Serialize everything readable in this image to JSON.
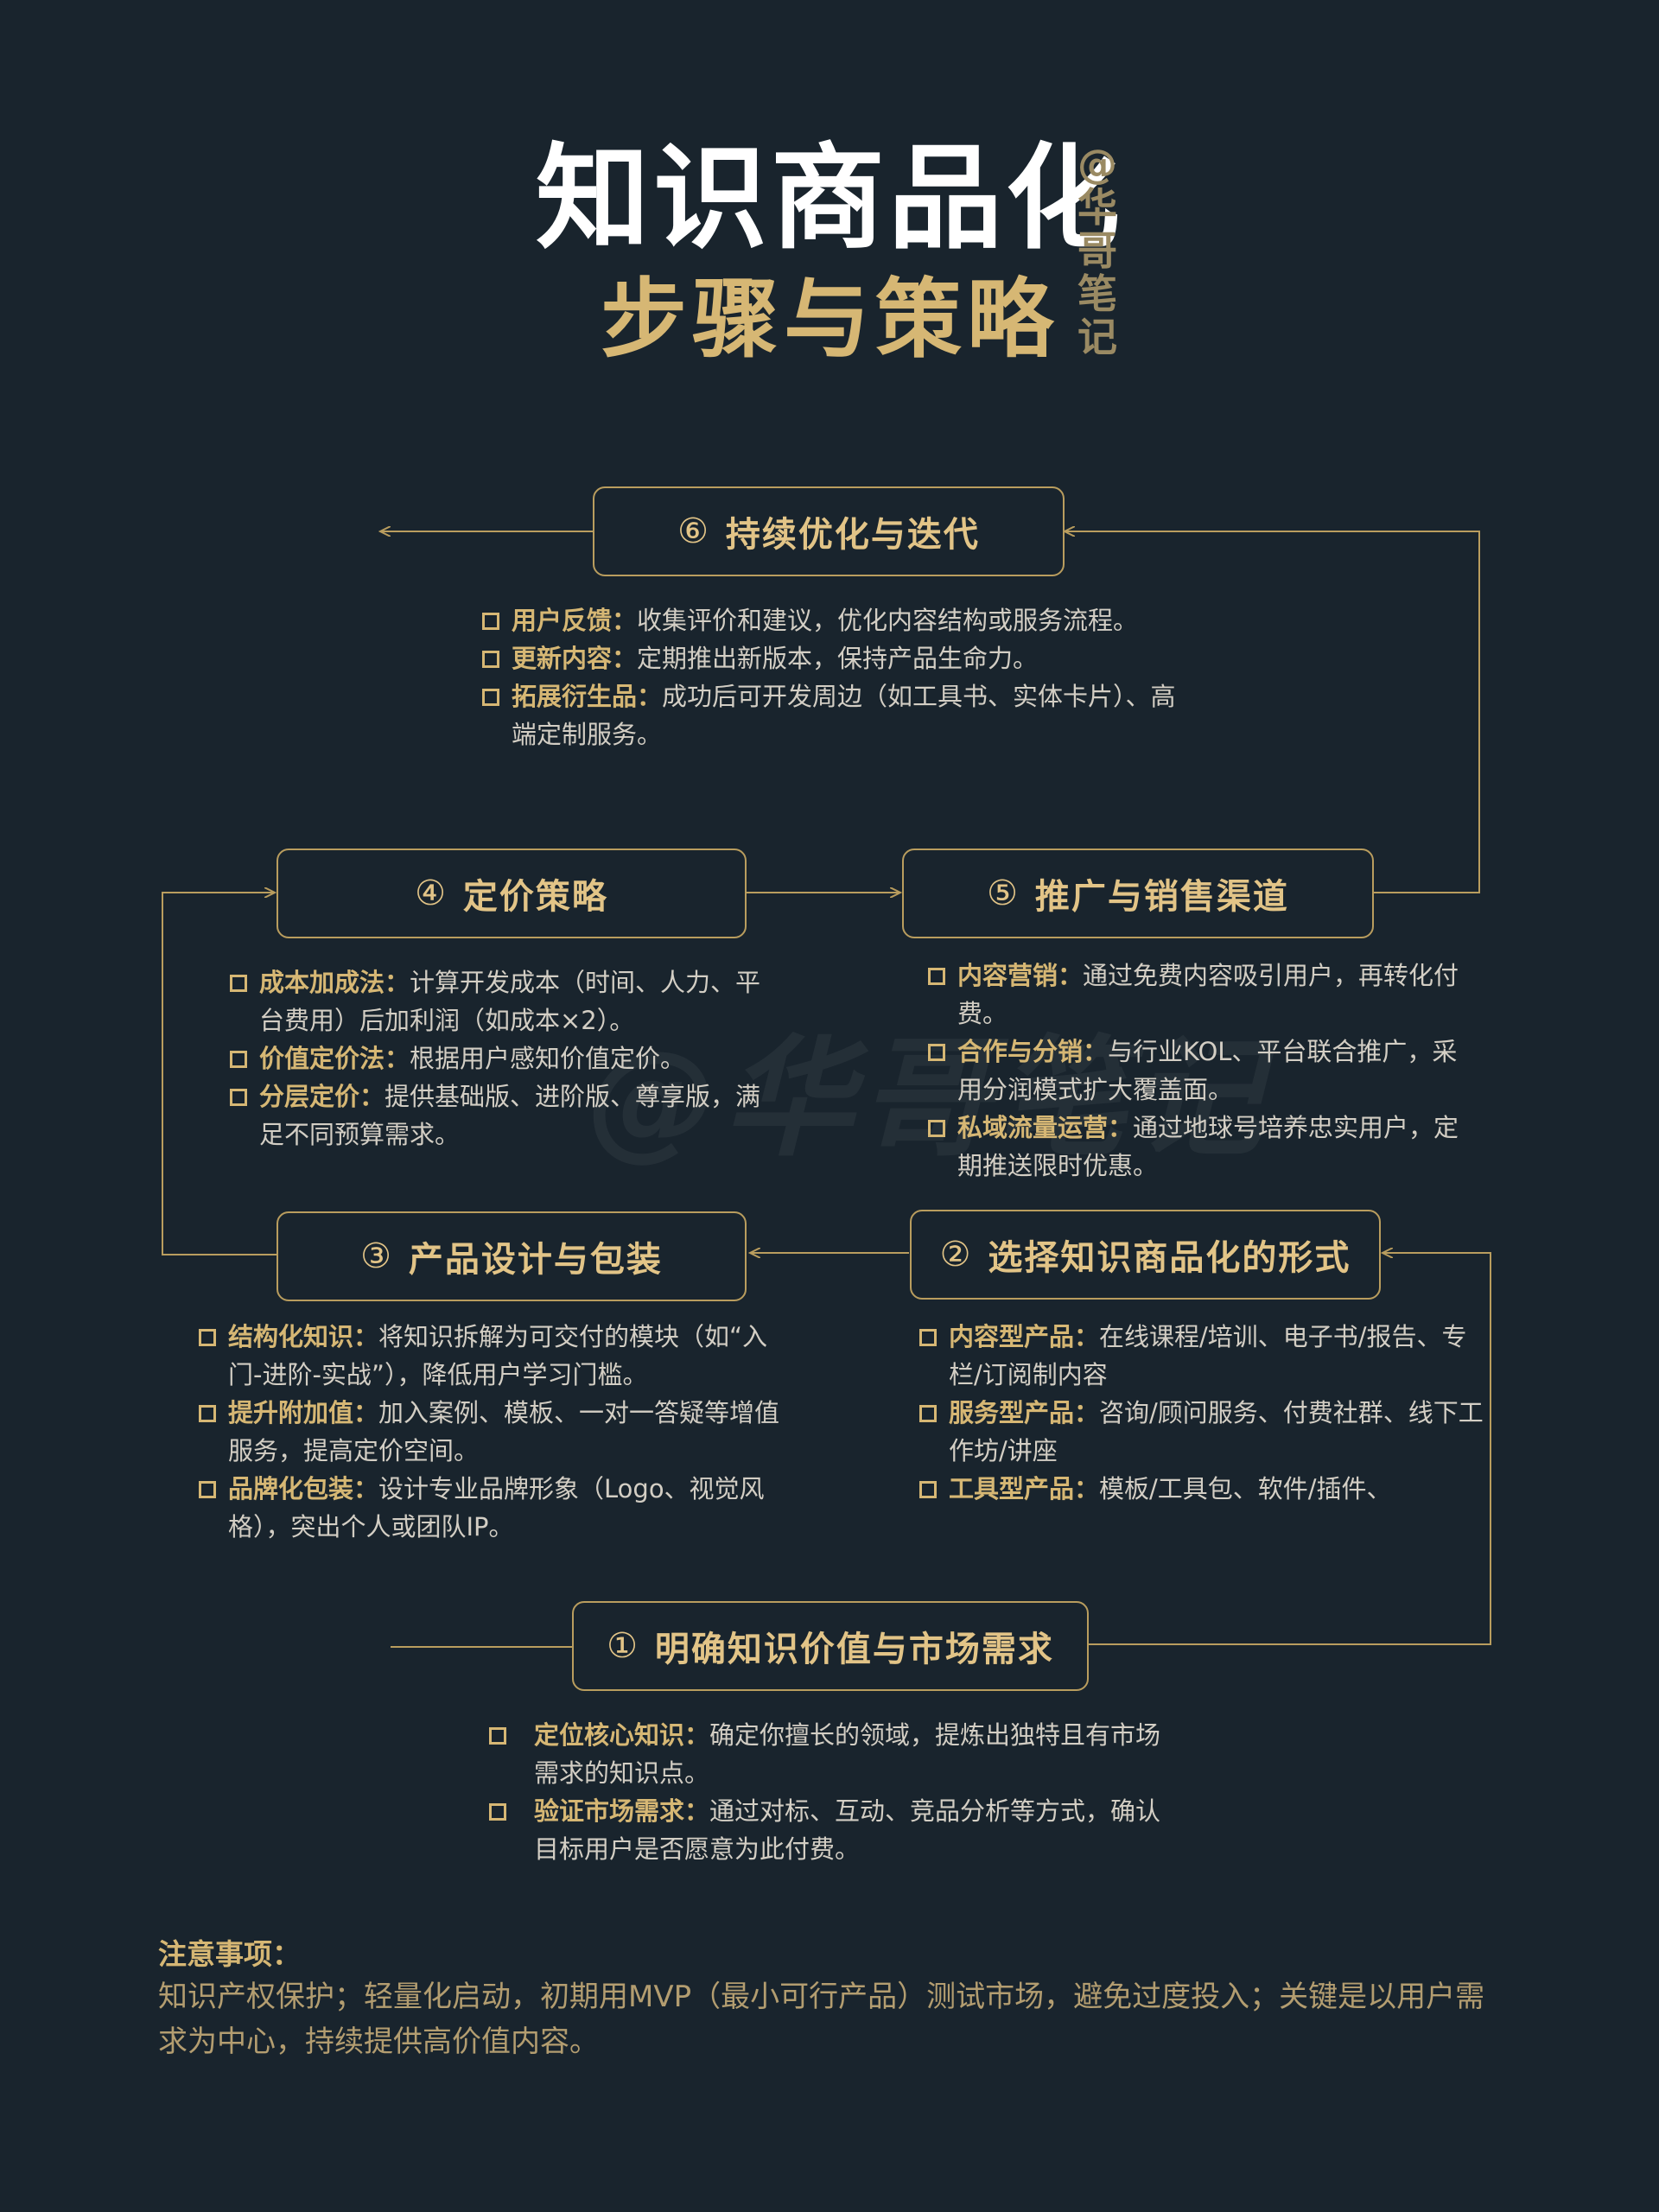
{
  "header": {
    "title": "知识商品化",
    "subtitle": "步骤与策略",
    "author_chars": [
      "@",
      "华",
      "哥",
      "笔",
      "记"
    ]
  },
  "watermark": "@华哥笔记",
  "steps": [
    {
      "num": "⑥",
      "title": "持续优化与迭代",
      "items": [
        {
          "key": "用户反馈：",
          "text": "收集评价和建议，优化内容结构或服务流程。"
        },
        {
          "key": "更新内容：",
          "text": "定期推出新版本，保持产品生命力。"
        },
        {
          "key": "拓展衍生品：",
          "text": "成功后可开发周边（如工具书、实体卡片）、高端定制服务。"
        }
      ]
    },
    {
      "num": "④",
      "title": "定价策略",
      "items": [
        {
          "key": "成本加成法：",
          "text": "计算开发成本（时间、人力、平台费用）后加利润（如成本×2）。"
        },
        {
          "key": "价值定价法：",
          "text": "根据用户感知价值定价。"
        },
        {
          "key": "分层定价：",
          "text": "提供基础版、进阶版、尊享版，满足不同预算需求。"
        }
      ]
    },
    {
      "num": "⑤",
      "title": "推广与销售渠道",
      "items": [
        {
          "key": "内容营销：",
          "text": "通过免费内容吸引用户，再转化付费。"
        },
        {
          "key": "合作与分销：",
          "text": "与行业KOL、平台联合推广，采用分润模式扩大覆盖面。"
        },
        {
          "key": "私域流量运营：",
          "text": "通过地球号培养忠实用户，定期推送限时优惠。"
        }
      ]
    },
    {
      "num": "③",
      "title": "产品设计与包装",
      "items": [
        {
          "key": "结构化知识：",
          "text": "将知识拆解为可交付的模块（如“入门-进阶-实战”），降低用户学习门槛。"
        },
        {
          "key": "提升附加值：",
          "text": "加入案例、模板、一对一答疑等增值服务，提高定价空间。"
        },
        {
          "key": "品牌化包装：",
          "text": "设计专业品牌形象（Logo、视觉风格），突出个人或团队IP。"
        }
      ]
    },
    {
      "num": "②",
      "title": "选择知识商品化的形式",
      "items": [
        {
          "key": "内容型产品：",
          "text": "在线课程/培训、电子书/报告、专栏/订阅制内容"
        },
        {
          "key": "服务型产品：",
          "text": "咨询/顾问服务、付费社群、线下工作坊/讲座"
        },
        {
          "key": "工具型产品：",
          "text": "模板/工具包、软件/插件、"
        }
      ]
    },
    {
      "num": "①",
      "title": "明确知识价值与市场需求",
      "items": [
        {
          "key": "定位核心知识：",
          "text": "确定你擅长的领域，提炼出独特且有市场需求的知识点。"
        },
        {
          "key": "验证市场需求：",
          "text": "通过对标、互动、竞品分析等方式，确认目标用户是否愿意为此付费。"
        }
      ]
    }
  ],
  "notes": {
    "title": "注意事项：",
    "text": "知识产权保护；轻量化启动，初期用MVP（最小可行产品）测试市场，避免过度投入；关键是以用户需求为中心，持续提供高价值内容。"
  },
  "colors": {
    "background": "#19242d",
    "accent": "#d6b774",
    "border": "#b99d5e",
    "body_text": "#d3cec4"
  }
}
